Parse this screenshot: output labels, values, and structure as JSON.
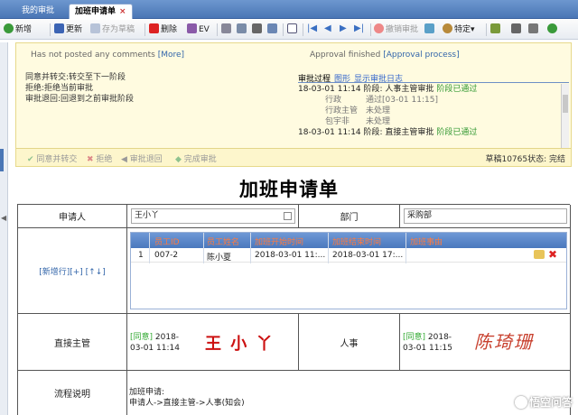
{
  "tabs": [
    {
      "label": "我的审批"
    },
    {
      "label": "加班申请单",
      "close": "×"
    }
  ],
  "toolbar": {
    "new": "新增",
    "update": "更新",
    "save_draft": "存为草稿",
    "delete": "删除",
    "ev": "EV",
    "revoke": "撤销审批",
    "specific": "特定"
  },
  "panel": {
    "no_comments": "Has not posted any comments",
    "more": "[More]",
    "finished": "Approval finished",
    "approval_process": "[Approval process]",
    "notes": [
      "同意并转交:转交至下一阶段",
      "拒绝:拒绝当前审批",
      "审批退回:回退到之前审批阶段"
    ],
    "log_tabs": {
      "process": "审批过程",
      "graph": "图形",
      "show_log": "显示审批日志"
    },
    "log": [
      {
        "time": "18-03-01 11:14",
        "stage": "阶段: 人事主管审批",
        "status": "阶段已通过"
      },
      {
        "role": "行政",
        "state": "通过[03-01 11:15]"
      },
      {
        "role": "行政主管",
        "state": "未处理"
      },
      {
        "role": "包宇非",
        "state": "未处理"
      },
      {
        "time": "18-03-01 11:14",
        "stage": "阶段: 直接主管审批",
        "status": "阶段已通过"
      }
    ],
    "actions": {
      "approve_forward": "同意并转交",
      "reject": "拒绝",
      "return": "审批退回",
      "complete": "完成审批"
    },
    "status": "草稿10765状态: 完结"
  },
  "form": {
    "title": "加班申请单",
    "applicant_label": "申请人",
    "applicant_value": "王小丫",
    "dept_label": "部门",
    "dept_value": "采购部",
    "add_row": "[新增行][+] [↑↓]",
    "grid_headers": [
      "员工ID",
      "员工姓名",
      "加班开始时间",
      "加班结束时间",
      "加班事由"
    ],
    "grid_rows": [
      {
        "no": "1",
        "id": "007-2",
        "name": "陈小夏",
        "start": "2018-03-01 11:...",
        "end": "2018-03-01 17:..."
      }
    ],
    "direct_label": "直接主管",
    "direct_tag": "[同意]",
    "direct_date1": "2018-",
    "direct_date2": "03-01 11:14",
    "direct_sig": "王 小 丫",
    "hr_label": "人事",
    "hr_tag": "[同意]",
    "hr_date1": "2018-",
    "hr_date2": "03-01 11:15",
    "hr_sig": "陈琦珊",
    "flow_label": "流程说明",
    "flow_line1": "加班申请:",
    "flow_line2": "申请人->直接主管->人事(知会)"
  },
  "watermark": "悟空问答"
}
